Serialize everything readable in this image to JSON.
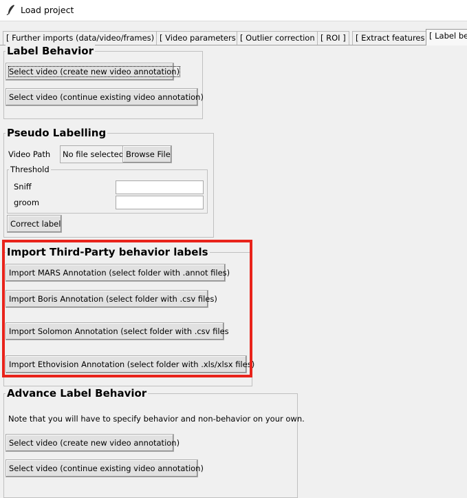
{
  "window": {
    "title": "Load project",
    "icon": "feather-icon"
  },
  "tabs": [
    {
      "label": "[ Further imports (data/video/frames) ]"
    },
    {
      "label": "[ Video parameters ]"
    },
    {
      "label": "[ Outlier correction ]"
    },
    {
      "label": "[ ROI ]"
    },
    {
      "label": "[ Extract features ]"
    },
    {
      "label": "[ Label beh"
    }
  ],
  "label_behavior": {
    "title": "Label Behavior",
    "new_btn": "Select video (create new video annotation)",
    "continue_btn": "Select video (continue existing video annotation)"
  },
  "pseudo": {
    "title": "Pseudo Labelling",
    "video_path_label": "Video Path",
    "file_status": "No file selected",
    "browse_btn": "Browse File",
    "threshold_title": "Threshold",
    "sniff_label": "Sniff",
    "sniff_value": "",
    "groom_label": "groom",
    "groom_value": "",
    "correct_btn": "Correct label"
  },
  "third_party": {
    "title": "Import Third-Party behavior labels",
    "mars_btn": "Import MARS Annotation (select folder with .annot files)",
    "boris_btn": "Import Boris Annotation (select folder with .csv files)",
    "solomon_btn": "Import Solomon Annotation (select folder with .csv files",
    "ethovision_btn": "Import Ethovision Annotation (select folder with .xls/xlsx files)"
  },
  "advanced": {
    "title": "Advance Label Behavior",
    "note": "Note that you will have to specify behavior and non-behavior on your own.",
    "new_btn": "Select video (create new video annotation)",
    "continue_btn": "Select video (continue existing video annotation)"
  },
  "colors": {
    "highlight": "#e8231b",
    "background": "#f0f0f0"
  }
}
